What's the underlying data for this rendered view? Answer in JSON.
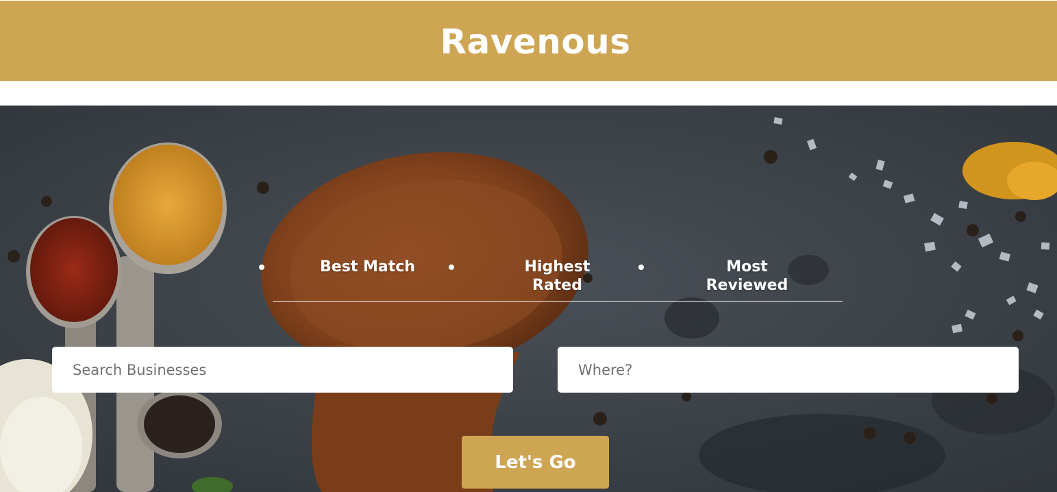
{
  "header": {
    "title": "Ravenous"
  },
  "colors": {
    "brand": "#cea553",
    "slate": "#3a4046",
    "text_light": "#ffffff"
  },
  "sort_options": [
    {
      "label": "Best Match"
    },
    {
      "label": "Highest Rated"
    },
    {
      "label": "Most Reviewed"
    }
  ],
  "search": {
    "business_placeholder": "Search Businesses",
    "business_value": "",
    "location_placeholder": "Where?",
    "location_value": ""
  },
  "actions": {
    "submit_label": "Let's Go"
  }
}
